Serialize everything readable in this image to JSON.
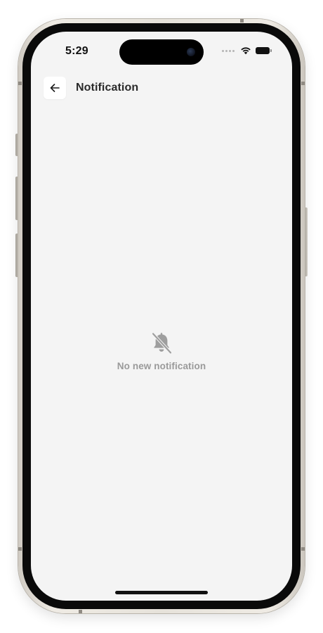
{
  "status_bar": {
    "time": "5:29",
    "icons": [
      "cellular-dots-icon",
      "wifi-icon",
      "battery-icon"
    ]
  },
  "header": {
    "back_icon": "arrow-left-icon",
    "title": "Notification"
  },
  "empty_state": {
    "icon": "bell-off-icon",
    "message": "No new notification"
  },
  "colors": {
    "screen_background": "#f4f4f4",
    "title_text": "#2a2a2a",
    "empty_text": "#9a9a9a",
    "icon_gray": "#9e9e9e"
  }
}
